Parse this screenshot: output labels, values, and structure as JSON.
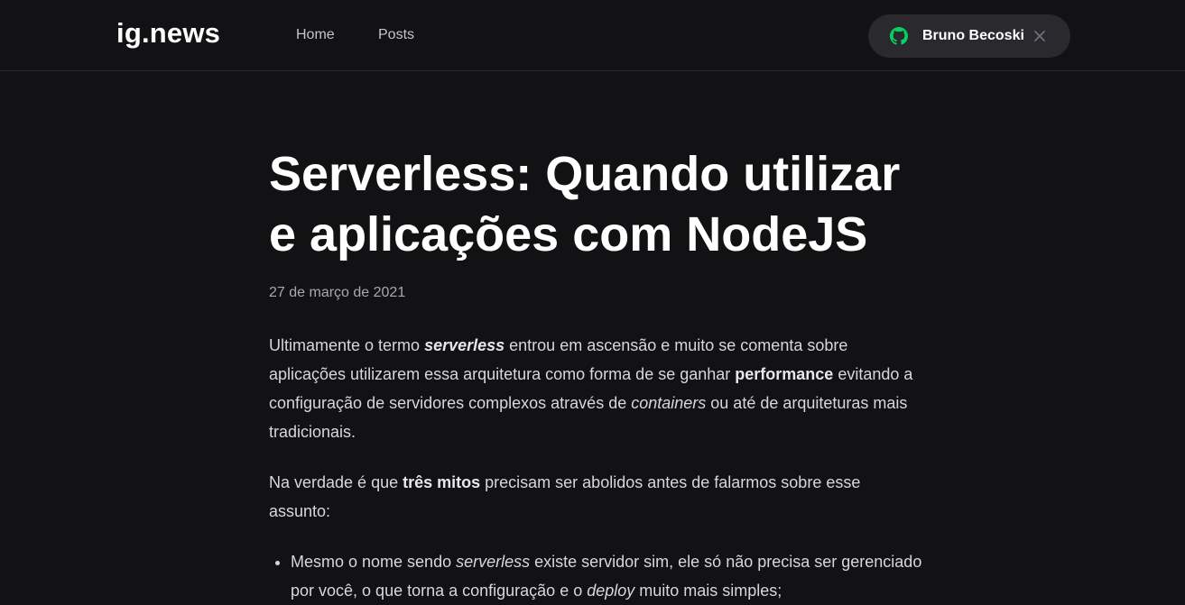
{
  "header": {
    "logo": "ig.news",
    "nav": {
      "home": "Home",
      "posts": "Posts"
    },
    "signin": {
      "user_name": "Bruno Becoski",
      "icon": "github-icon",
      "close_icon": "close-icon",
      "icon_color": "#04d361"
    }
  },
  "post": {
    "title": "Serverless: Quando utilizar e aplicações com NodeJS",
    "date": "27 de março de 2021",
    "paragraph1": {
      "t1": "Ultimamente o termo ",
      "kw1": "serverless",
      "t2": " entrou em ascensão e muito se comenta sobre aplicações utilizarem essa arquitetura como forma de se ganhar ",
      "kw2": "performance",
      "t3": " evitando a configuração de servidores complexos através de ",
      "kw3": "containers",
      "t4": " ou até de arquiteturas mais tradicionais."
    },
    "paragraph2": {
      "t1": "Na verdade é que ",
      "kw1": "três mitos",
      "t2": " precisam ser abolidos antes de falarmos sobre esse assunto:"
    },
    "list": [
      {
        "t1": "Mesmo o nome sendo ",
        "kw1": "serverless",
        "t2": " existe servidor sim, ele só não precisa ser gerenciado por você, o que torna a configuração e o ",
        "kw2": "deploy",
        "t3": " muito mais simples;"
      }
    ]
  },
  "colors": {
    "background": "#121214",
    "header_border": "#29292e",
    "signin_background": "#29292e",
    "accent_green": "#04d361",
    "text": "#e1e1e6",
    "muted": "#a8a8b3"
  }
}
